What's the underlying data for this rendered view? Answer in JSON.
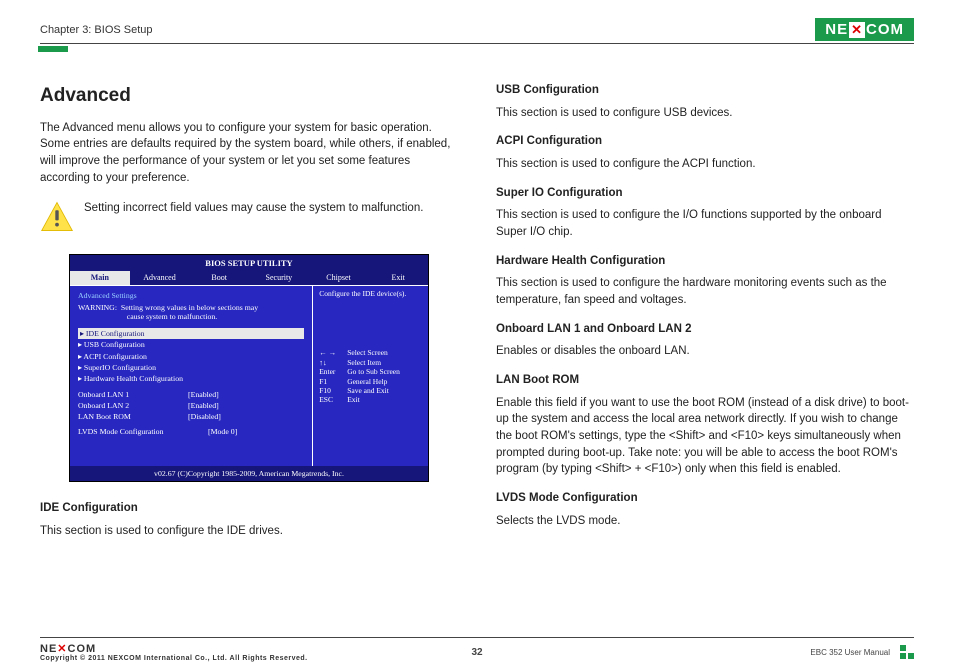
{
  "header": {
    "chapter": "Chapter 3: BIOS Setup",
    "logo_text": "NE COM"
  },
  "left": {
    "title": "Advanced",
    "intro": "The Advanced menu allows you to configure your system for basic operation. Some entries are defaults required by the system board, while others, if enabled, will improve the performance of your system or let you set some features according to your preference.",
    "warning": "Setting incorrect field values may cause the system to malfunction.",
    "ide_head": "IDE Configuration",
    "ide_body": "This section is used to configure the IDE drives."
  },
  "bios": {
    "util_title": "BIOS SETUP UTILITY",
    "menu": [
      "Main",
      "Advanced",
      "Boot",
      "Security",
      "Chipset",
      "Exit"
    ],
    "adv_settings": "Advanced Settings",
    "warn_line": "WARNING:  Setting wrong values in below sections may\n                         cause system to malfunction.",
    "items": [
      "▸ IDE Configuration",
      "▸ USB Configuration",
      "▸ ACPI Configuration",
      "▸ SuperIO Configuration",
      "▸ Hardware Health Configuration"
    ],
    "kv": [
      {
        "k": "Onboard LAN 1",
        "v": "[Enabled]"
      },
      {
        "k": "Onboard LAN 2",
        "v": "[Enabled]"
      },
      {
        "k": "LAN Boot ROM",
        "v": "[Disabled]"
      }
    ],
    "lvds": {
      "k": "LVDS Mode Configuration",
      "v": "[Mode 0]"
    },
    "right_desc": "Configure the IDE device(s).",
    "keys": [
      {
        "k": "← →",
        "v": "Select Screen"
      },
      {
        "k": "↑↓",
        "v": "Select Item"
      },
      {
        "k": "Enter",
        "v": "Go to Sub Screen"
      },
      {
        "k": "F1",
        "v": "General Help"
      },
      {
        "k": "F10",
        "v": "Save and Exit"
      },
      {
        "k": "ESC",
        "v": "Exit"
      }
    ],
    "footer": "v02.67 (C)Copyright 1985-2009, American Megatrends, Inc."
  },
  "right": {
    "sections": [
      {
        "h": "USB Configuration",
        "b": "This section is used to configure USB devices."
      },
      {
        "h": "ACPI Configuration",
        "b": "This section is used to configure the ACPI function."
      },
      {
        "h": "Super IO Configuration",
        "b": "This section is used to configure the I/O functions supported by the onboard Super I/O chip."
      },
      {
        "h": "Hardware Health Configuration",
        "b": "This section is used to configure the hardware monitoring events such as the temperature, fan speed and voltages."
      },
      {
        "h": "Onboard LAN 1 and Onboard LAN 2",
        "b": "Enables or disables the onboard LAN."
      },
      {
        "h": "LAN Boot ROM",
        "b": "Enable this field if you want to use the boot ROM (instead of a disk drive) to boot-up the system and access the local area network directly. If you wish to change the boot ROM's settings, type the <Shift> and <F10> keys simultaneously when prompted during boot-up. Take note: you will be able to access the boot ROM's program (by typing <Shift> + <F10>) only when this field is enabled."
      },
      {
        "h": "LVDS Mode Configuration",
        "b": "Selects the LVDS mode."
      }
    ]
  },
  "footer": {
    "logo": "NEXCOM",
    "copyright": "Copyright © 2011 NEXCOM International Co., Ltd. All Rights Reserved.",
    "page": "32",
    "manual": "EBC 352 User Manual"
  }
}
